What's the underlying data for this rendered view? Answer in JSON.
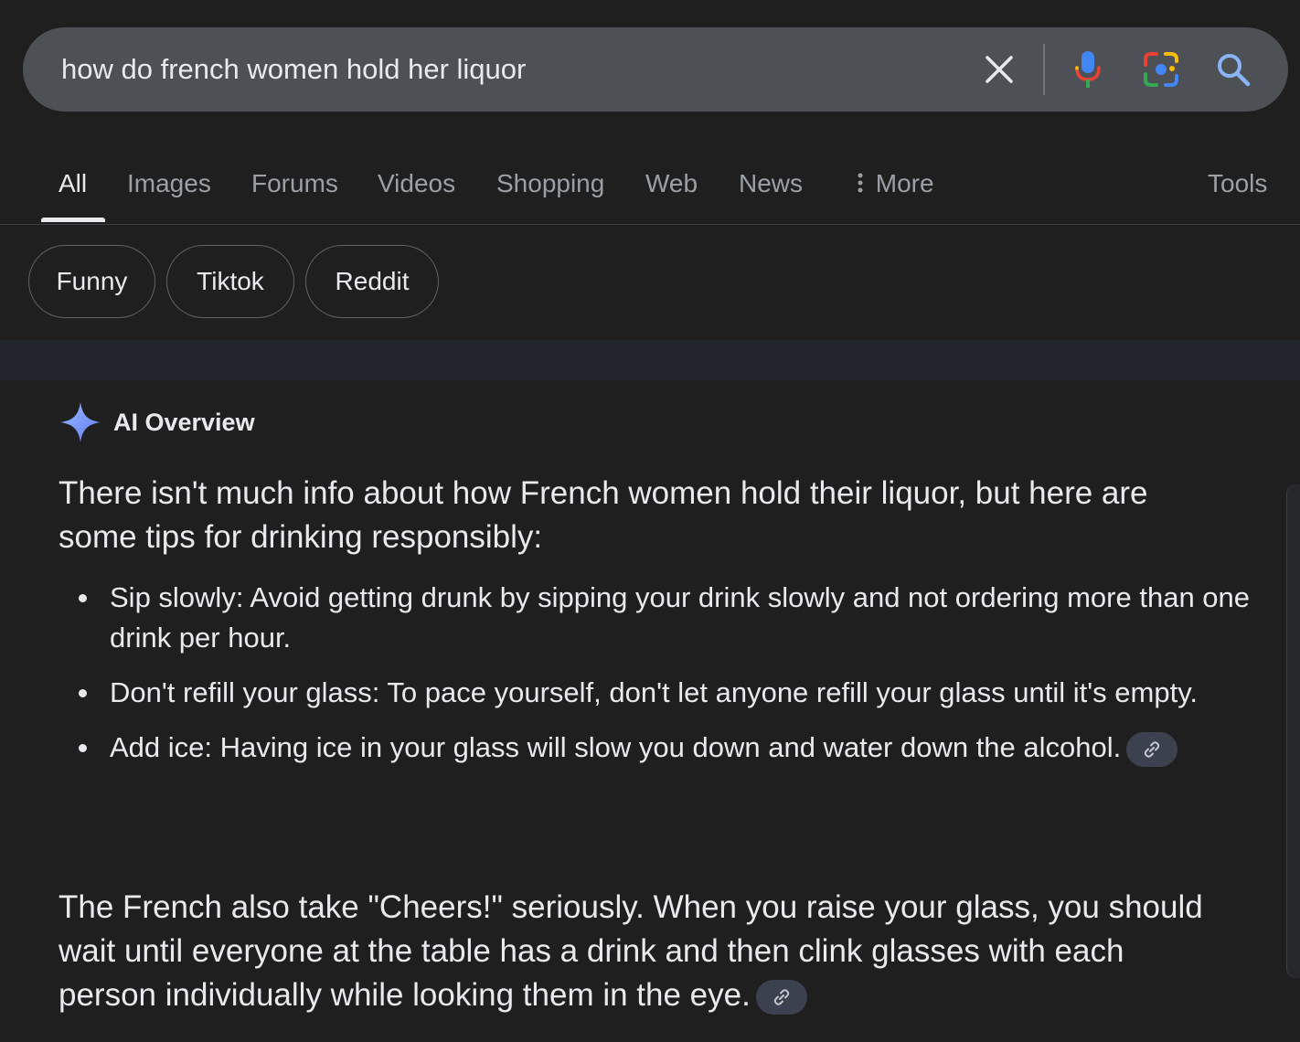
{
  "search": {
    "query": "how do french women hold her liquor"
  },
  "tabs": [
    {
      "label": "All"
    },
    {
      "label": "Images"
    },
    {
      "label": "Forums"
    },
    {
      "label": "Videos"
    },
    {
      "label": "Shopping"
    },
    {
      "label": "Web"
    },
    {
      "label": "News"
    },
    {
      "label": "More"
    }
  ],
  "tools_label": "Tools",
  "chips": [
    {
      "label": "Funny"
    },
    {
      "label": "Tiktok"
    },
    {
      "label": "Reddit"
    }
  ],
  "overview": {
    "title": "AI Overview",
    "intro": "There isn't much info about how French women hold their liquor, but here are some tips for drinking responsibly:",
    "tips": [
      {
        "text": "Sip slowly: Avoid getting drunk by sipping your drink slowly and not ordering more than one drink per hour."
      },
      {
        "text": "Don't refill your glass: To pace yourself, don't let anyone refill your glass until it's empty."
      },
      {
        "text": "Add ice: Having ice in your glass will slow you down and water down the alcohol."
      }
    ],
    "outro": "The French also take \"Cheers!\" seriously. When you raise your glass, you should wait until everyone at the table has a drink and then clink glasses with each person individually while looking them in the eye."
  },
  "colors": {
    "background": "#1f1f1f",
    "searchbar": "#4d5156",
    "text": "#e8eaed",
    "muted": "#9aa0a6"
  }
}
